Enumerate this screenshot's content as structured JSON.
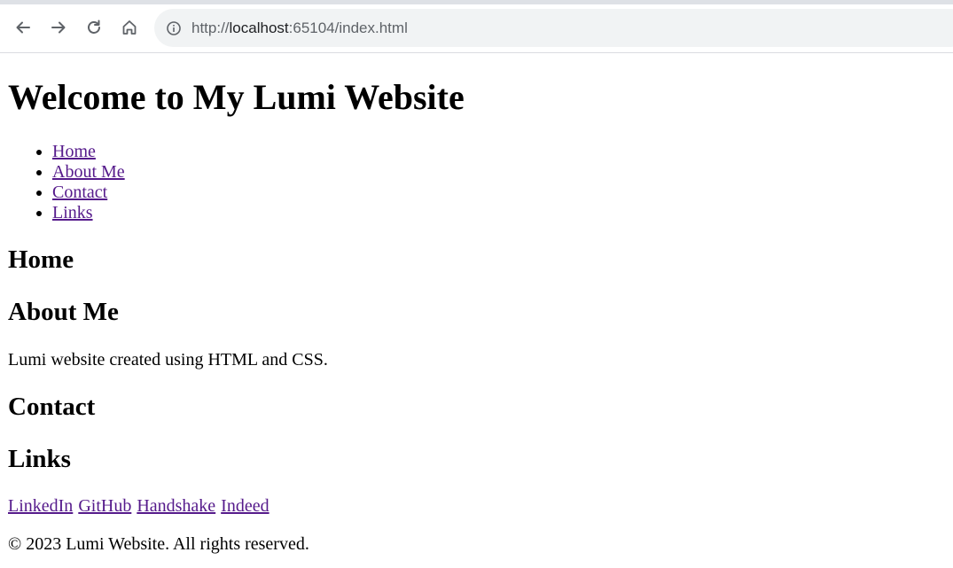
{
  "browser": {
    "url_scheme": "http://",
    "url_host": "localhost",
    "url_rest": ":65104/index.html"
  },
  "page": {
    "title": "Welcome to My Lumi Website",
    "nav": [
      "Home",
      "About Me",
      "Contact",
      "Links"
    ],
    "sections": {
      "home": {
        "heading": "Home"
      },
      "about": {
        "heading": "About Me",
        "text": "Lumi website created using HTML and CSS."
      },
      "contact": {
        "heading": "Contact"
      },
      "links": {
        "heading": "Links",
        "items": [
          "LinkedIn",
          "GitHub",
          "Handshake",
          "Indeed"
        ]
      }
    },
    "footer": "© 2023 Lumi Website. All rights reserved."
  },
  "colors": {
    "visited_link": "#551a8b",
    "address_bar": "#f1f3f4"
  },
  "icons": [
    "back-arrow-icon",
    "forward-arrow-icon",
    "reload-icon",
    "home-icon",
    "info-icon"
  ]
}
